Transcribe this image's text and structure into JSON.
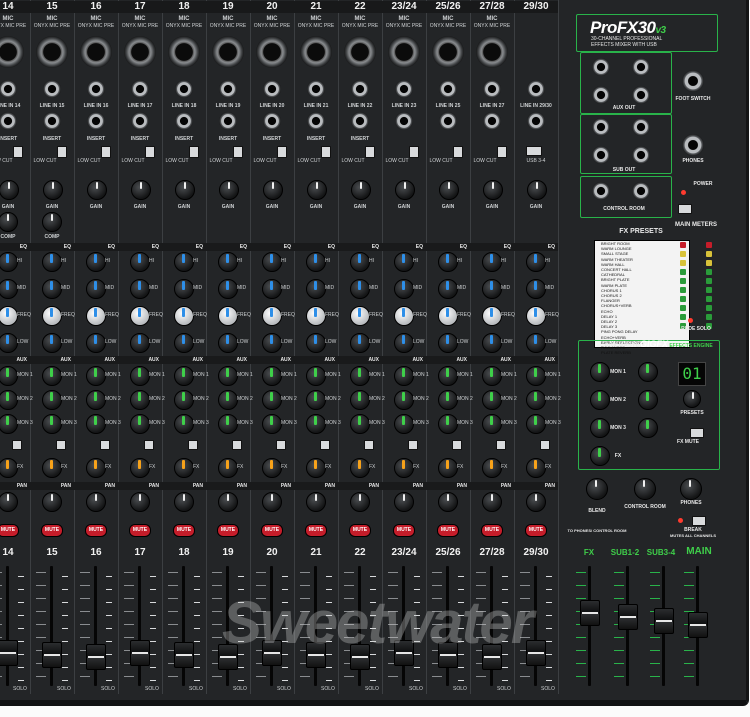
{
  "channels": [
    {
      "num": "14",
      "type": "MIC",
      "pre": "ONYX MIC PRE",
      "line": "LINE IN 14",
      "big": "14"
    },
    {
      "num": "15",
      "type": "MIC",
      "pre": "ONYX MIC PRE",
      "line": "LINE IN 15",
      "big": "15"
    },
    {
      "num": "16",
      "type": "MIC",
      "pre": "ONYX MIC PRE",
      "line": "LINE IN 16",
      "big": "16"
    },
    {
      "num": "17",
      "type": "MIC",
      "pre": "ONYX MIC PRE",
      "line": "LINE IN 17",
      "big": "17"
    },
    {
      "num": "18",
      "type": "MIC",
      "pre": "ONYX MIC PRE",
      "line": "LINE IN 18",
      "big": "18"
    },
    {
      "num": "19",
      "type": "MIC",
      "pre": "ONYX MIC PRE",
      "line": "LINE IN 19",
      "big": "19"
    },
    {
      "num": "20",
      "type": "MIC",
      "pre": "ONYX MIC PRE",
      "line": "LINE IN 20",
      "big": "20"
    },
    {
      "num": "21",
      "type": "MIC",
      "pre": "ONYX MIC PRE",
      "line": "LINE IN 21",
      "big": "21"
    },
    {
      "num": "22",
      "type": "MIC",
      "pre": "ONYX MIC PRE",
      "line": "LINE IN 22",
      "big": "22"
    },
    {
      "num": "23/24",
      "type": "MIC",
      "pre": "ONYX MIC PRE",
      "line": "LINE IN 23",
      "big": "23/24"
    },
    {
      "num": "25/26",
      "type": "MIC",
      "pre": "ONYX MIC PRE",
      "line": "LINE IN 25",
      "big": "25/26"
    },
    {
      "num": "27/28",
      "type": "MIC",
      "pre": "ONYX MIC PRE",
      "line": "LINE IN 27",
      "big": "27/28"
    },
    {
      "num": "29/30",
      "type": "",
      "pre": "",
      "line": "LINE IN 29/30",
      "big": "29/30"
    }
  ],
  "strip_labels": {
    "insert": "INSERT",
    "low_cut": "LOW CUT",
    "gain": "GAIN",
    "comp": "COMP",
    "eq": "EQ",
    "hi": "HI",
    "mid": "MID",
    "freq": "FREQ",
    "low": "LOW",
    "aux": "AUX",
    "mon1": "MON 1",
    "mon2": "MON 2",
    "mon3": "MON 3",
    "fx": "FX",
    "pan": "PAN",
    "mute": "MUTE",
    "usb34": "USB 3-4",
    "solo": "SOLO"
  },
  "master": {
    "brand_pro": "Pro",
    "brand_fx": "FX30",
    "brand_v": "v3",
    "subtitle1": "30-CHANNEL PROFESSIONAL",
    "subtitle2": "EFFECTS MIXER WITH USB",
    "aux_out": "AUX OUT",
    "sub_out": "SUB OUT",
    "control_room": "CONTROL ROOM",
    "foot_switch": "FOOT SWITCH",
    "phones": "PHONES",
    "power": "POWER",
    "main_meters": "MAIN METERS",
    "rude_solo": "RUDE SOLO",
    "fx_presets_title": "FX PRESETS",
    "fx_presets": [
      "BRIGHT ROOM",
      "WARM LOUNGE",
      "SMALL STAGE",
      "WARM THEATER",
      "WARM HALL",
      "CONCERT HALL",
      "CATHEDRAL",
      "BRIGHT PLATE",
      "WARM PLATE",
      "CHORUS 1",
      "CHORUS 2",
      "FLANGER",
      "CHORUS+VERB",
      "ECHO",
      "DELAY 1",
      "DELAY 2",
      "DELAY 3",
      "PING PONG DELAY",
      "ECHO+VERB",
      "EARLY REFLECTIONS",
      "ROOM VERB",
      "PLATE REVERB"
    ],
    "aux_master": "AUX MASTER",
    "gigfx": "GIGFX",
    "effects_engine": "EFFECTS ENGINE",
    "mon1": "MON 1",
    "mon2": "MON 2",
    "mon3": "MON 3",
    "fx": "FX",
    "presets": "PRESETS",
    "preset_display": "01",
    "fx_mute": "FX MUTE",
    "blend": "BLEND",
    "control_room_knob": "CONTROL ROOM",
    "break": "BREAK",
    "mutes_all": "MUTES ALL CHANNELS",
    "to_phones": "TO PHONES/ CONTROL ROOM",
    "bus_fx": "FX",
    "bus_sub12": "SUB1-2",
    "bus_sub34": "SUB3-4",
    "bus_main": "MAIN"
  },
  "colors": {
    "eq_accent": "#2e8fe8",
    "aux_accent": "#3fcf4a",
    "pan_accent": "#f7a21a",
    "mute_red": "#c51d2a",
    "master_green": "#29b34a"
  },
  "watermark": "Sweetwater"
}
